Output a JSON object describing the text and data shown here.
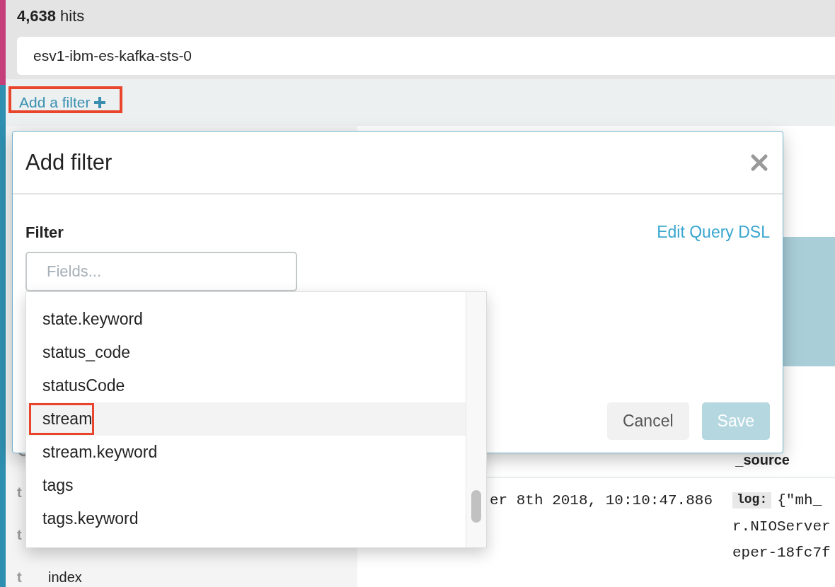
{
  "hits": {
    "count": "4,638",
    "label": "hits"
  },
  "query": {
    "value": "esv1-ibm-es-kafka-sts-0"
  },
  "filter_bar": {
    "link": "Add a filter",
    "highlighted": true
  },
  "sidebar": {
    "fields": [
      {
        "kind": "time"
      },
      {
        "kind": "string",
        "type": "t"
      },
      {
        "kind": "string",
        "type": "t"
      },
      {
        "kind": "string",
        "type": "t",
        "name": "index"
      }
    ]
  },
  "table": {
    "columns": [
      "_source"
    ],
    "rows": [
      {
        "time": "er 8th 2018, 10:10:47.886",
        "source_key": "log:",
        "source_lines": [
          "{\"mh_",
          "r.NIOServer",
          "eper-18fc7f"
        ]
      }
    ]
  },
  "modal": {
    "title": "Add filter",
    "section": "Filter",
    "link": "Edit Query DSL",
    "field": {
      "placeholder": "Fields..."
    },
    "dropdown": [
      {
        "label": "state.keyword",
        "selected": false,
        "highlighted": false
      },
      {
        "label": "status_code",
        "selected": false,
        "highlighted": false
      },
      {
        "label": "statusCode",
        "selected": false,
        "highlighted": false
      },
      {
        "label": "stream",
        "selected": true,
        "highlighted": true
      },
      {
        "label": "stream.keyword",
        "selected": false,
        "highlighted": false
      },
      {
        "label": "tags",
        "selected": false,
        "highlighted": false
      },
      {
        "label": "tags.keyword",
        "selected": false,
        "highlighted": false
      }
    ],
    "buttons": [
      {
        "label": "Cancel",
        "disabled": false
      },
      {
        "label": "Save",
        "disabled": true
      }
    ]
  }
}
